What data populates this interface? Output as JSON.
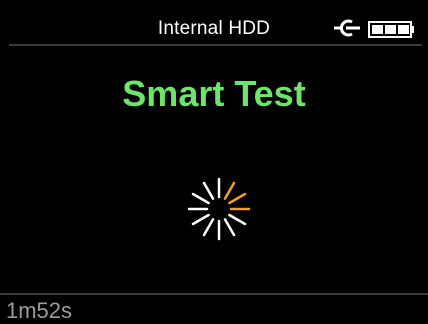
{
  "header": {
    "title": "Internal HDD",
    "icons": [
      "power-plug-icon",
      "battery-icon"
    ],
    "battery_level": 1.0
  },
  "main": {
    "title": "Smart Test",
    "title_color": "#6fe36a",
    "spinner": {
      "icon": "loading-spinner-icon",
      "active_color": "#f0a028",
      "inactive_color": "#ffffff"
    }
  },
  "footer": {
    "elapsed": "1m52s"
  }
}
